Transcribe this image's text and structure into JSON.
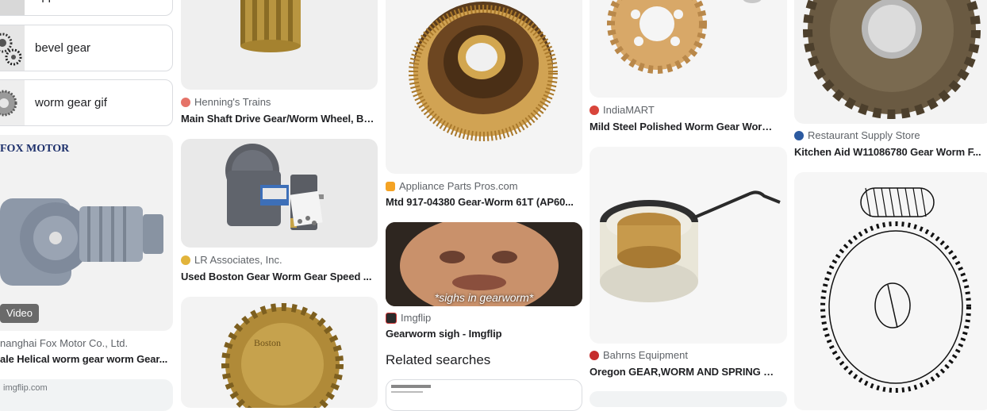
{
  "related_chips": [
    {
      "label": "application"
    },
    {
      "label": "bevel gear"
    },
    {
      "label": "worm gear gif"
    }
  ],
  "col1": {
    "card_overlay_text": "FOX MOTOR",
    "video_badge": "Video",
    "source": "nanghai Fox Motor Co., Ltd.",
    "title": "ale Helical worm gear worm Gear...",
    "footer_source": "imgflip.com"
  },
  "col2": {
    "card1": {
      "source": "Henning's Trains",
      "title": "Main Shaft Drive Gear/Worm Wheel, Br..."
    },
    "card2": {
      "source": "LR Associates, Inc.",
      "title": "Used Boston Gear Worm Gear Speed ..."
    }
  },
  "col3": {
    "card1": {
      "source": "Appliance Parts Pros.com",
      "title": "Mtd 917-04380 Gear-Worm 61T (AP60..."
    },
    "card2": {
      "caption": "*sighs in gearworm*",
      "source": "Imgflip",
      "title": "Gearworm sigh - Imgflip"
    },
    "related_heading": "Related searches"
  },
  "col4": {
    "card1": {
      "source": "IndiaMART",
      "title": "Mild Steel Polished Worm Gear Worm ..."
    },
    "card2": {
      "source": "Bahrns Equipment",
      "title": "Oregon GEAR,WORM AND SPRING FO..."
    }
  },
  "col5": {
    "card1": {
      "source": "Restaurant Supply Store",
      "title": "Kitchen Aid W11086780 Gear Worm F..."
    }
  },
  "colors": {
    "text": "#202124",
    "secondary": "#5f6368",
    "border": "#dadce0",
    "brass": "#c9a24a"
  }
}
